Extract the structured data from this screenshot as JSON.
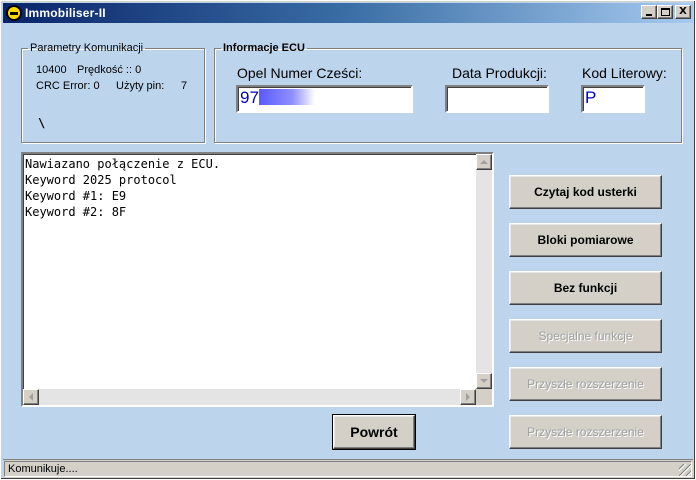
{
  "window": {
    "title": "Immobiliser-II",
    "controls": {
      "minimize": "_",
      "maximize": "□",
      "close": "X"
    }
  },
  "comm": {
    "legend": "Parametry Komunikacji",
    "baud": "10400",
    "speed_label": "Prędkość :: 0",
    "crc_label": "CRC Error: 0",
    "pin_label": "Użyty pin:",
    "pin_value": "7",
    "spinner": "\\"
  },
  "ecu": {
    "legend": "Informacje ECU",
    "part_number_label": "Opel Numer Cześci:",
    "part_number_value": "97",
    "production_date_label": "Data Produkcji:",
    "production_date_value": "",
    "letter_code_label": "Kod Literowy:",
    "letter_code_value": "P"
  },
  "log": {
    "lines": [
      "Nawiazano połączenie z ECU.",
      "Keyword 2025 protocol",
      "Keyword #1: E9",
      "Keyword #2: 8F"
    ]
  },
  "buttons": {
    "read_codes": "Czytaj kod usterki",
    "measure_blocks": "Bloki pomiarowe",
    "no_function": "Bez funkcji",
    "special_functions": "Specjalne funkcje",
    "future_ext_1": "Przyszłe rozszerzenie",
    "future_ext_2": "Przyszłe rozszerzenie",
    "back": "Powrót"
  },
  "status": {
    "text": "Komunikuje...."
  },
  "colors": {
    "window_bg": "#bcd4ec",
    "title_start": "#0a246a",
    "title_end": "#a6caf0",
    "field_text": "#0000cc"
  }
}
